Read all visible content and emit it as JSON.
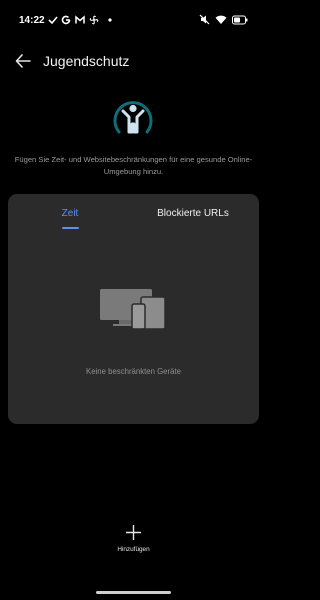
{
  "status_bar": {
    "time": "14:22",
    "icons": [
      "check-icon",
      "google-icon",
      "gmail-icon",
      "fan-icon",
      "dot-icon",
      "mute-icon",
      "wifi-icon",
      "battery-icon"
    ]
  },
  "header": {
    "title": "Jugendschutz"
  },
  "hero": {
    "icon": "parental-control-icon",
    "description": "Fügen Sie Zeit- und Websitebeschränkungen für eine gesunde Online-Umgebung hinzu."
  },
  "tabs": [
    {
      "label": "Zeit",
      "active": true
    },
    {
      "label": "Blockierte URLs",
      "active": false
    }
  ],
  "empty_state": {
    "icon": "devices-icon",
    "text": "Keine beschränkten Geräte"
  },
  "bottom_action": {
    "icon": "plus-icon",
    "label": "Hinzufügen"
  },
  "colors": {
    "background": "#000000",
    "card": "#2b2b2b",
    "accent": "#5f8ff0",
    "teal": "#0e6f7a"
  }
}
